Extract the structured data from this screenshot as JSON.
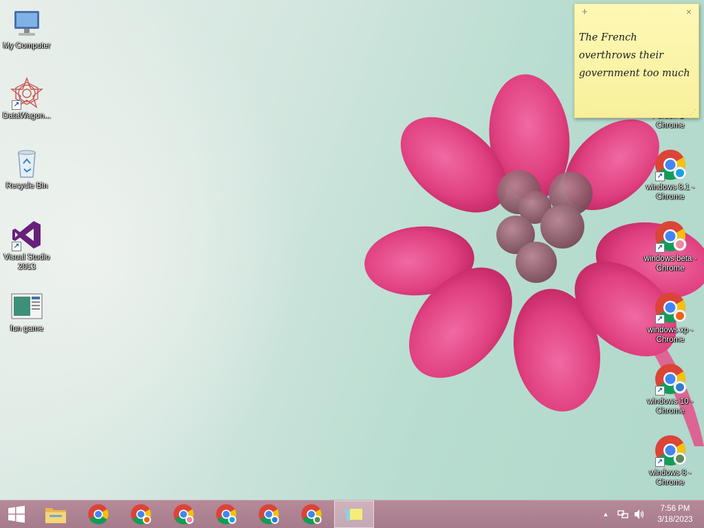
{
  "desktop": {
    "left_icons": [
      {
        "label": "My Computer",
        "icon": "computer-icon"
      },
      {
        "label": "DataWagon...",
        "icon": "datawagon-icon"
      },
      {
        "label": "Recycle Bin",
        "icon": "recycle-bin-icon"
      },
      {
        "label": "Visual Studio 2013",
        "icon": "visual-studio-icon"
      },
      {
        "label": "fun game",
        "icon": "game-window-icon"
      }
    ],
    "right_icons": [
      {
        "label": "Person 1 - Chrome",
        "icon": "chrome-profile-icon"
      },
      {
        "label": "windows 8.1 - Chrome",
        "icon": "chrome-profile-icon"
      },
      {
        "label": "windows beta - Chrome",
        "icon": "chrome-profile-icon"
      },
      {
        "label": "windows xp - Chrome",
        "icon": "chrome-profile-icon"
      },
      {
        "label": "windows 10 - Chrome",
        "icon": "chrome-profile-icon"
      },
      {
        "label": "windows 8 - Chrome",
        "icon": "chrome-profile-icon"
      }
    ]
  },
  "sticky_note": {
    "text": "The French overthrows their government too much",
    "new_symbol": "+",
    "close_symbol": "×"
  },
  "taskbar": {
    "pinned": [
      "file-explorer-icon",
      "chrome-icon",
      "chrome-profile-icon",
      "chrome-profile-icon",
      "chrome-profile-icon",
      "chrome-profile-icon",
      "chrome-profile-icon",
      "sticky-notes-icon"
    ],
    "clock": {
      "time": "7:56 PM",
      "date": "3/18/2023"
    }
  },
  "colors": {
    "taskbar": "#a67b8b",
    "sticky": "#fdf8b6",
    "flower": "#e0407f",
    "chrome_red": "#db4437",
    "chrome_yellow": "#f4c20d",
    "chrome_green": "#0f9d58",
    "chrome_blue": "#4285f4"
  }
}
